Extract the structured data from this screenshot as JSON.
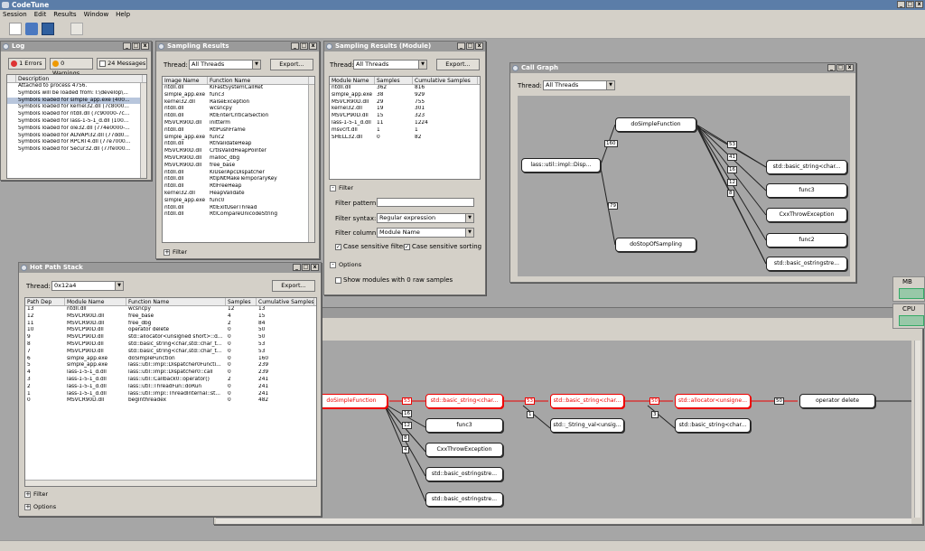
{
  "app": {
    "title": "CodeTune"
  },
  "menu": [
    "Session",
    "Edit",
    "Results",
    "Window",
    "Help"
  ],
  "log": {
    "title": "Log",
    "errors": "1 Errors",
    "warnings": "0 Warnings",
    "messages": "24 Messages",
    "column": "Description",
    "rows": [
      "Attached to process 4756.",
      "Symbols will be loaded from: I:\\develop\\...",
      "Symbols loaded for simple_app.exe (400...",
      "Symbols loaded for kernel32.dll (7c8000...",
      "Symbols loaded for ntdll.dll (7c90000-7c...",
      "Symbols loaded for lass-1-5-1_d.dll (100...",
      "Symbols loaded for ole32.dll (774e0000-...",
      "Symbols loaded for ADVAPI32.dll (77dd0...",
      "Symbols loaded for RPCRT4.dll (77e7000...",
      "Symbols loaded for Secur32.dll (77fe000..."
    ]
  },
  "sampling": {
    "title": "Sampling Results",
    "thread_label": "Thread:",
    "thread_value": "All Threads",
    "export": "Export...",
    "columns": [
      "Image Name",
      "Function Name"
    ],
    "rows": [
      [
        "ntdll.dll",
        "KiFastSystemCallRet"
      ],
      [
        "simple_app.exe",
        "func3"
      ],
      [
        "kernel32.dll",
        "RaiseException"
      ],
      [
        "ntdll.dll",
        "wcsncpy"
      ],
      [
        "ntdll.dll",
        "RtlEnterCriticalSection"
      ],
      [
        "MSVCR90D.dll",
        "initterm"
      ],
      [
        "ntdll.dll",
        "RtlPushFrame"
      ],
      [
        "simple_app.exe",
        "func2"
      ],
      [
        "ntdll.dll",
        "RtlValidateHeap"
      ],
      [
        "MSVCR90D.dll",
        "CrtIsValidHeapPointer"
      ],
      [
        "MSVCR90D.dll",
        "malloc_dbg"
      ],
      [
        "MSVCR90D.dll",
        "free_base"
      ],
      [
        "ntdll.dll",
        "KiUserApcDispatcher"
      ],
      [
        "ntdll.dll",
        "RtlpNtMakeTemporaryKey"
      ],
      [
        "ntdll.dll",
        "RtlFreeHeap"
      ],
      [
        "kernel32.dll",
        "HeapValidate"
      ],
      [
        "simple_app.exe",
        "func0"
      ],
      [
        "ntdll.dll",
        "RtlExitUserThread"
      ],
      [
        "ntdll.dll",
        "RtlCompareUnicodeString"
      ]
    ],
    "filter": "Filter"
  },
  "module": {
    "title": "Sampling Results (Module)",
    "thread_label": "Thread:",
    "thread_value": "All Threads",
    "export": "Export...",
    "columns": [
      "Module Name",
      "Samples",
      "Cumulative Samples"
    ],
    "rows": [
      [
        "ntdll.dll",
        "362",
        "816"
      ],
      [
        "simple_app.exe",
        "38",
        "929"
      ],
      [
        "MSVCR90D.dll",
        "29",
        "755"
      ],
      [
        "kernel32.dll",
        "19",
        "301"
      ],
      [
        "MSVCP90D.dll",
        "15",
        "323"
      ],
      [
        "lass-1-5-1_d.dll",
        "11",
        "1224"
      ],
      [
        "msvcrt.dll",
        "1",
        "1"
      ],
      [
        "SHELL32.dll",
        "0",
        "82"
      ]
    ],
    "filter_section": "Filter",
    "filter_pattern": "Filter pattern:",
    "filter_syntax": "Filter syntax:",
    "syntax_value": "Regular expression",
    "filter_column": "Filter column:",
    "column_value": "Module Name",
    "case_filter": "Case sensitive filter",
    "case_sort": "Case sensitive sorting",
    "options": "Options",
    "show_modules": "Show modules with 0 raw samples"
  },
  "callgraph": {
    "title": "Call Graph",
    "thread_label": "Thread:",
    "thread_value": "All Threads",
    "nodes": {
      "root": "lass::util::impl::Disp...",
      "dsf": "doSimpleFunction",
      "dsos": "doStopOfSampling",
      "s1": "std::basic_string<char...",
      "f3": "func3",
      "cte": "CxxThrowException",
      "f2": "func2",
      "s2": "std::basic_ostringstre..."
    },
    "edges": {
      "e160": "160",
      "e79": "79",
      "e53": "53",
      "e41": "41",
      "e16": "16",
      "e12": "12",
      "e8": "8"
    }
  },
  "hotpath": {
    "title": "Hot Path Stack",
    "thread_label": "Thread:",
    "thread_value": "0x12a4",
    "export": "Export...",
    "columns": [
      "Path Dep",
      "Module Name",
      "Function Name",
      "Samples",
      "Cumulative Samples"
    ],
    "rows": [
      [
        "13",
        "ntdll.dll",
        "wcsncpy",
        "12",
        "13"
      ],
      [
        "12",
        "MSVCR90D.dll",
        "free_base",
        "4",
        "15"
      ],
      [
        "11",
        "MSVCR90D.dll",
        "free_dbg",
        "2",
        "84"
      ],
      [
        "10",
        "MSVCP90D.dll",
        "operator delete",
        "0",
        "50"
      ],
      [
        "9",
        "MSVCP90D.dll",
        "std::allocator<unsigned short>::d...",
        "0",
        "50"
      ],
      [
        "8",
        "MSVCP90D.dll",
        "std::basic_string<char,std::char_t...",
        "0",
        "53"
      ],
      [
        "7",
        "MSVCP90D.dll",
        "std::basic_string<char,std::char_t...",
        "0",
        "53"
      ],
      [
        "6",
        "simple_app.exe",
        "doSimpleFunction",
        "0",
        "160"
      ],
      [
        "5",
        "simple_app.exe",
        "lass::util::impl::Dispatcher0Functi...",
        "0",
        "239"
      ],
      [
        "4",
        "lass-1-5-1_d.dll",
        "lass::util::impl::Dispatcher0::call",
        "0",
        "239"
      ],
      [
        "3",
        "lass-1-5-1_d.dll",
        "lass::util::Callback0::operator()",
        "2",
        "241"
      ],
      [
        "2",
        "lass-1-5-1_d.dll",
        "lass::util::ThreadFun::doRun",
        "0",
        "241"
      ],
      [
        "1",
        "lass-1-5-1_d.dll",
        "lass::util::impl::ThreadInternal::st...",
        "0",
        "241"
      ],
      [
        "0",
        "MSVCR90D.dll",
        "beginthreadex",
        "0",
        "482"
      ]
    ],
    "filter": "Filter",
    "options": "Options"
  },
  "hotgraph": {
    "nodes": {
      "dsf": "doSimpleFunction",
      "s1": "std::basic_string<char...",
      "s2": "std::basic_string<char...",
      "alloc": "std::allocator<unsigne...",
      "opdel": "operator delete",
      "f3": "func3",
      "sv": "std::_String_val<unsig...",
      "s3": "std::basic_string<char...",
      "cte": "CxxThrowException",
      "os1": "std::basic_ostringstre...",
      "os2": "std::basic_ostringstre..."
    },
    "edges": {
      "a": "53",
      "b": "53",
      "c": "50",
      "d": "50",
      "e": "16",
      "f": "12",
      "g": "8",
      "h": "4",
      "i": "1",
      "j": "3"
    }
  },
  "gadgets": {
    "mb": "MB",
    "cpu": "CPU"
  }
}
